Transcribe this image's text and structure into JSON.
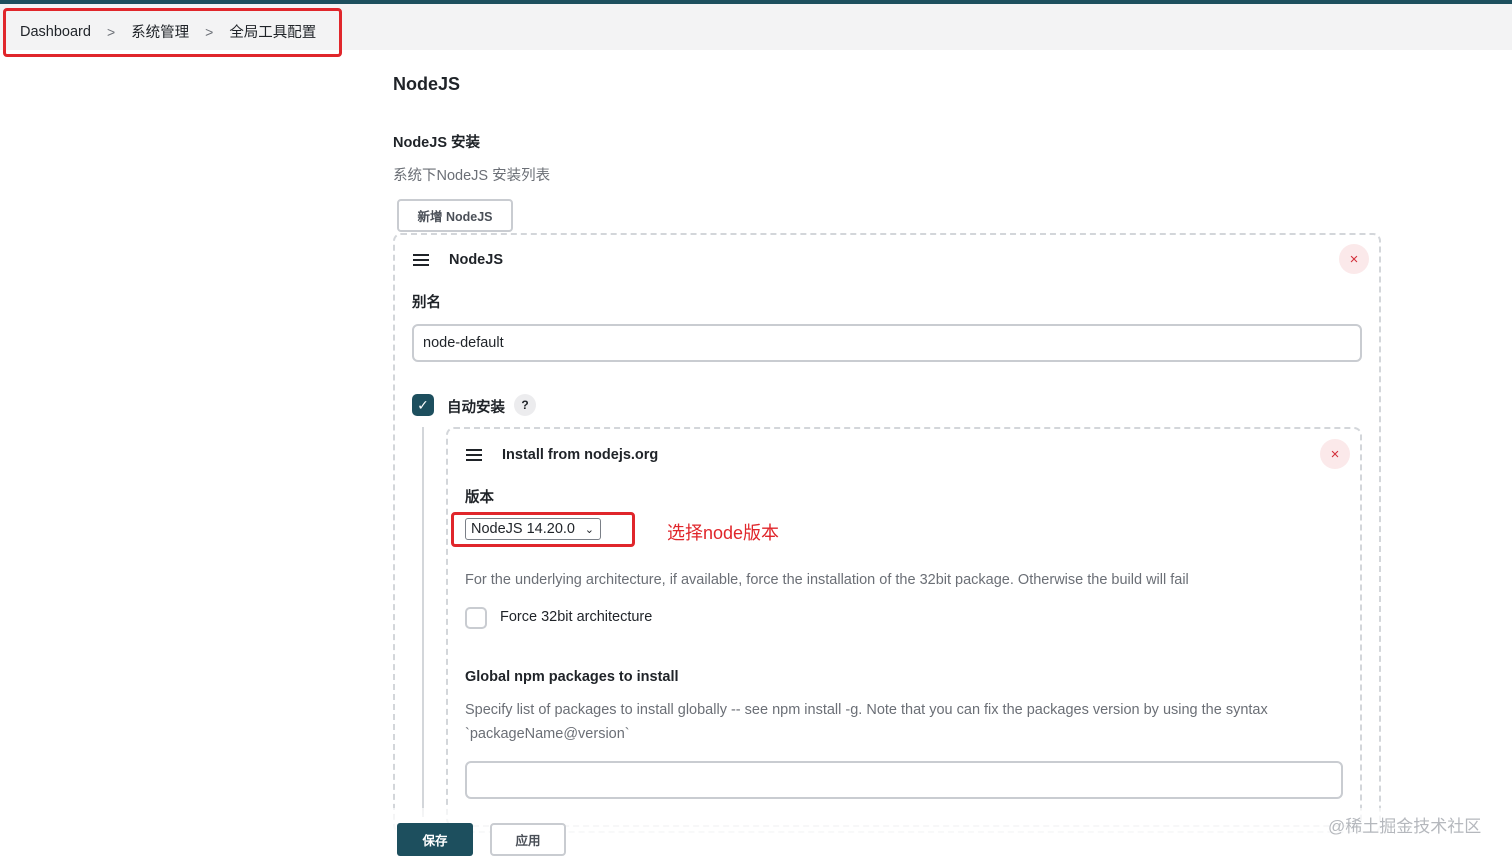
{
  "breadcrumb": {
    "items": [
      "Dashboard",
      "系统管理",
      "全局工具配置"
    ],
    "separator": ">"
  },
  "section": {
    "title": "NodeJS",
    "install_title": "NodeJS 安装",
    "install_desc": "系统下NodeJS 安装列表",
    "add_button": "新增 NodeJS"
  },
  "nodejs_card": {
    "title": "NodeJS",
    "close": "×",
    "alias_label": "别名",
    "alias_value": "node-default",
    "auto_install_label": "自动安装",
    "auto_install_checked": true,
    "help": "?"
  },
  "installer_card": {
    "title": "Install from nodejs.org",
    "close": "×",
    "version_label": "版本",
    "version_selected": "NodeJS 14.20.0",
    "annotation": "选择node版本",
    "arch_help": "For the underlying architecture, if available, force the installation of the 32bit package. Otherwise the build will fail",
    "force32_label": "Force 32bit architecture",
    "force32_checked": false,
    "npm_label": "Global npm packages to install",
    "npm_help_line1": "Specify list of packages to install globally -- see npm install -g. Note that you can fix the packages version by using the syntax",
    "npm_help_line2": "`packageName@version`",
    "npm_value": ""
  },
  "footer": {
    "save_label": "保存",
    "apply_label": "应用"
  },
  "watermark": "@稀土掘金技术社区",
  "colors": {
    "accent": "#1d4f5e",
    "annotation_red": "#e0262b",
    "close_red": "#d32f3a"
  }
}
